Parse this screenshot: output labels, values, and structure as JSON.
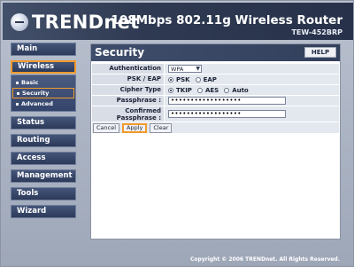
{
  "header": {
    "logo": "TRENDnet",
    "product_title": "108Mbps 802.11g Wireless Router",
    "model": "TEW-452BRP"
  },
  "sidebar": {
    "main": "Main",
    "wireless": "Wireless",
    "wireless_items": [
      "Basic",
      "Security",
      "Advanced"
    ],
    "status": "Status",
    "routing": "Routing",
    "access": "Access",
    "management": "Management",
    "tools": "Tools",
    "wizard": "Wizard"
  },
  "page": {
    "title": "Security",
    "help": "HELP"
  },
  "form": {
    "auth_type_label": "Authentication Type",
    "auth_type_value": "WPA",
    "psk_eap_label": "PSK / EAP",
    "psk_label": "PSK",
    "eap_label": "EAP",
    "cipher_label": "Cipher Type",
    "tkip_label": "TKIP",
    "aes_label": "AES",
    "auto_label": "Auto",
    "passphrase_label": "Passphrase :",
    "passphrase_value": "••••••••••••••••••",
    "confirm_label_line1": "Confirmed",
    "confirm_label_line2": "Passphrase :",
    "confirm_value": "••••••••••••••••••"
  },
  "buttons": {
    "cancel": "Cancel",
    "apply": "Apply",
    "clear": "Clear"
  },
  "footer": {
    "copyright": "Copyright © 2006 TRENDnet. All Rights Reserved."
  },
  "colors": {
    "accent": "#f29a2e",
    "nav": "#2d3a59"
  }
}
